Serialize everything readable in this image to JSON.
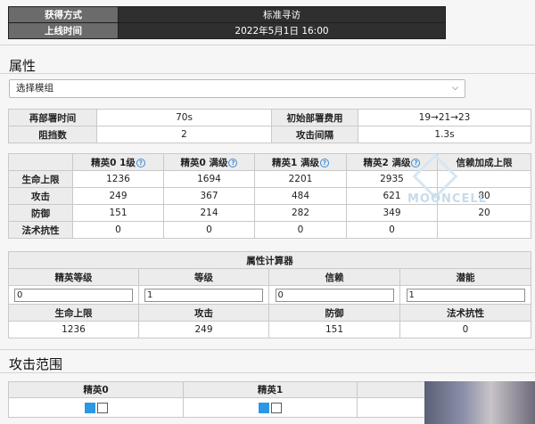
{
  "info": {
    "rows": [
      {
        "key": "获得方式",
        "value": "标准寻访"
      },
      {
        "key": "上线时间",
        "value": "2022年5月1日 16:00"
      }
    ]
  },
  "attributes": {
    "title": "属性",
    "module_select": "选择模组",
    "deploy": {
      "redeploy_label": "再部署时间",
      "redeploy_value": "70s",
      "cost_label": "初始部署费用",
      "cost_value": "19→21→23",
      "block_label": "阻挡数",
      "block_value": "2",
      "interval_label": "攻击间隔",
      "interval_value": "1.3s"
    },
    "stats": {
      "headers": [
        "",
        "精英0 1级",
        "精英0 满级",
        "精英1 满级",
        "精英2 满级",
        "信赖加成上限"
      ],
      "rows": [
        {
          "label": "生命上限",
          "values": [
            "1236",
            "1694",
            "2201",
            "2935",
            ""
          ]
        },
        {
          "label": "攻击",
          "values": [
            "249",
            "367",
            "484",
            "621",
            "80"
          ]
        },
        {
          "label": "防御",
          "values": [
            "151",
            "214",
            "282",
            "349",
            "20"
          ]
        },
        {
          "label": "法术抗性",
          "values": [
            "0",
            "0",
            "0",
            "0",
            ""
          ]
        }
      ]
    },
    "calculator": {
      "title": "属性计算器",
      "input_labels": [
        "精英等级",
        "等级",
        "信赖",
        "潜能"
      ],
      "input_values": [
        "0",
        "1",
        "0",
        "1"
      ],
      "result_labels": [
        "生命上限",
        "攻击",
        "防御",
        "法术抗性"
      ],
      "result_values": [
        "1236",
        "249",
        "151",
        "0"
      ]
    }
  },
  "attack_range": {
    "title": "攻击范围",
    "headers": [
      "精英0",
      "精英1"
    ]
  },
  "watermark": "MOONCELL",
  "colors": {
    "self_cell": "#2c97e6",
    "dark_header": "#2f2f2f"
  }
}
